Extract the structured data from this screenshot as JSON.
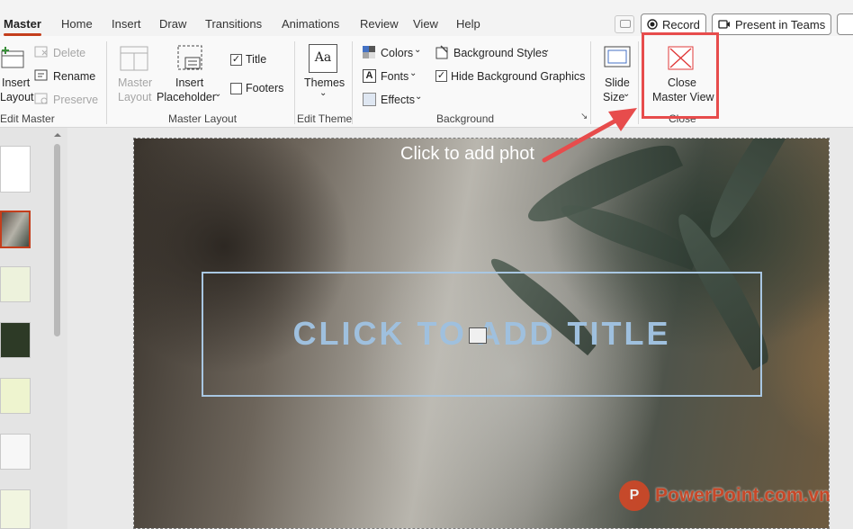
{
  "tabs": [
    "Master",
    "Home",
    "Insert",
    "Draw",
    "Transitions",
    "Animations",
    "Review",
    "View",
    "Help"
  ],
  "top_buttons": {
    "record": "Record",
    "present": "Present in Teams"
  },
  "ribbon": {
    "edit_master": {
      "insert_label": "Insert",
      "layout_label": "Layout",
      "delete": "Delete",
      "rename": "Rename",
      "preserve": "Preserve",
      "group": "Edit Master"
    },
    "master_layout": {
      "master_label": "Master",
      "layout_label": "Layout",
      "insert_label": "Insert",
      "placeholder_label": "Placeholder",
      "title_check": "Title",
      "footers_check": "Footers",
      "group": "Master Layout"
    },
    "edit_theme": {
      "themes": "Themes",
      "group": "Edit Theme"
    },
    "background": {
      "colors": "Colors",
      "fonts": "Fonts",
      "effects": "Effects",
      "background_styles": "Background Styles",
      "hide_bg_graphics": "Hide Background Graphics",
      "group": "Background"
    },
    "size": {
      "slide_label": "Slide",
      "size_label": "Size"
    },
    "close": {
      "close_label": "Close",
      "master_view_label": "Master View",
      "group": "Close"
    }
  },
  "slide": {
    "subtitle_placeholder": "Click to add phot",
    "title_placeholder": "CLICK TO ADD TITLE"
  },
  "watermark": {
    "logo": "P",
    "text": "PowerPoint.com.vn"
  },
  "colors": {
    "accent": "#c43e1c",
    "annotation": "#e74c4c",
    "placeholder_border": "#a9c7e2"
  }
}
